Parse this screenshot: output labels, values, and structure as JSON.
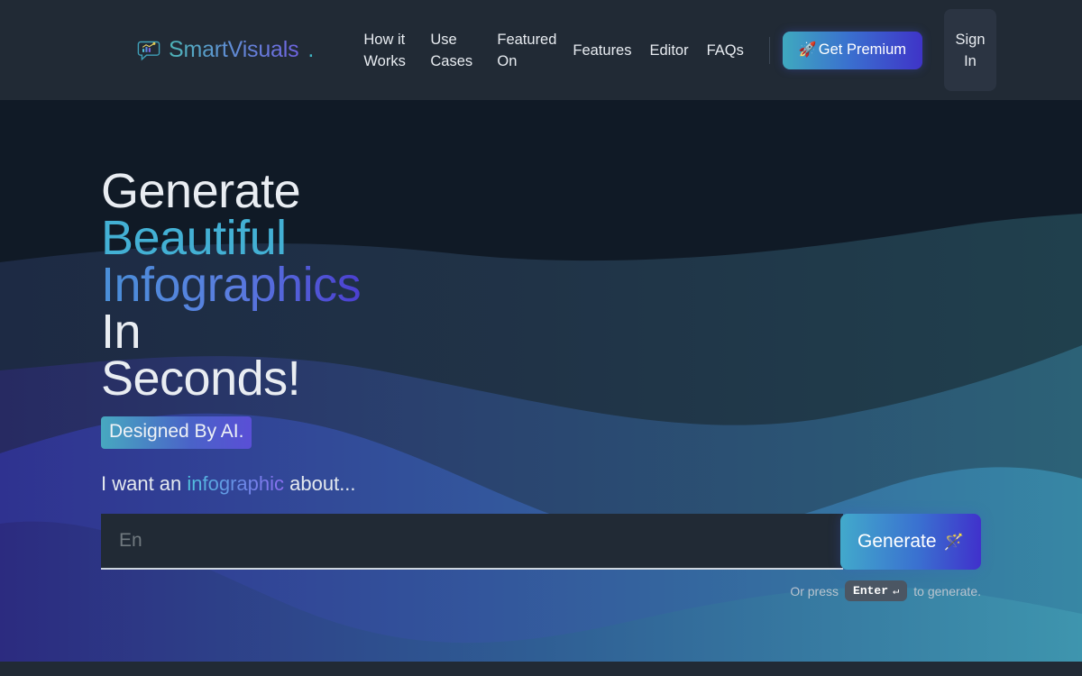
{
  "header": {
    "logo": {
      "icon": "chat-chart-icon",
      "text": "SmartVisuals",
      "dot": "."
    },
    "nav": [
      {
        "label": "How it Works"
      },
      {
        "label": "Use Cases"
      },
      {
        "label": "Featured On"
      },
      {
        "label": "Features"
      },
      {
        "label": "Editor"
      },
      {
        "label": "FAQs"
      }
    ],
    "premium_button": {
      "label": "Get Premium",
      "icon": "🚀"
    },
    "signin_button": {
      "label": "Sign In"
    }
  },
  "hero": {
    "headline": {
      "line1": "Generate",
      "line2": "Beautiful",
      "line3": "Infographics",
      "line3_tail": " In",
      "line4": "Seconds!"
    },
    "badge": "Designed By AI.",
    "subline": {
      "pre": "I want an ",
      "highlight": "infographic",
      "post": " about..."
    },
    "search": {
      "placeholder": "En",
      "value": ""
    },
    "generate_button": {
      "label": "Generate",
      "icon": "🪄"
    },
    "hint": {
      "pre": "Or press",
      "key": "Enter",
      "key_symbol": "↵",
      "post": "to generate."
    }
  },
  "colors": {
    "header_bg": "#212a35",
    "hero_bg": "#101a26",
    "accent_teal": "#43b0d4",
    "accent_blue": "#4a8fd8",
    "accent_purple": "#4b3fd0",
    "wave_indigo": "#2a2a7e",
    "wave_teal": "#3e92ab"
  }
}
